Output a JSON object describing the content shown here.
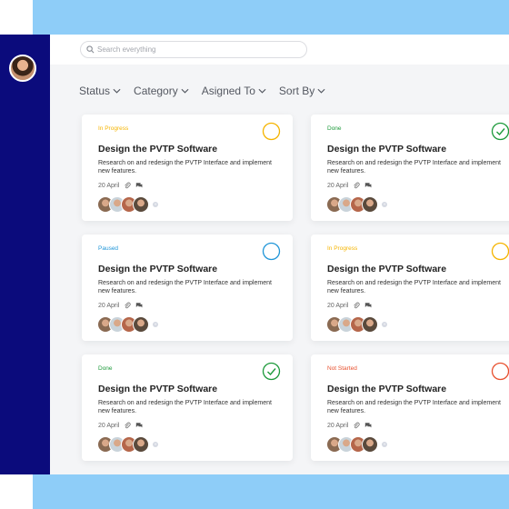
{
  "search": {
    "placeholder": "Search everything"
  },
  "filters": [
    {
      "label": "Status"
    },
    {
      "label": "Category"
    },
    {
      "label": "Asigned To"
    },
    {
      "label": "Sort By"
    }
  ],
  "status_colors": {
    "In Progress": "#f5b400",
    "Done": "#1d9a3b",
    "Paused": "#2196d8",
    "Not Started": "#e8512f"
  },
  "cards": [
    {
      "status": "In Progress",
      "title": "Design the PVTP Software",
      "description": "Research on and redesign the PVTP Interface and implement new features.",
      "date": "20 April"
    },
    {
      "status": "Done",
      "title": "Design the PVTP Software",
      "description": "Research on and redesign the PVTP Interface and implement new features.",
      "date": "20 April"
    },
    {
      "status": "Paused",
      "title": "Design the PVTP Software",
      "description": "Research on and redesign the PVTP Interface and implement new features.",
      "date": "20 April"
    },
    {
      "status": "In Progress",
      "title": "Design the PVTP Software",
      "description": "Research on and redesign the PVTP Interface and implement new features.",
      "date": "20 April"
    },
    {
      "status": "Done",
      "title": "Design the PVTP Software",
      "description": "Research on and redesign the PVTP Interface and implement new features.",
      "date": "20 April"
    },
    {
      "status": "Not Started",
      "title": "Design the PVTP Software",
      "description": "Research on and redesign the PVTP Interface and implement new features.",
      "date": "20 April"
    }
  ],
  "avatar_colors": [
    "#8a6a52",
    "#c9d3da",
    "#b5664a",
    "#5a4a3c"
  ]
}
